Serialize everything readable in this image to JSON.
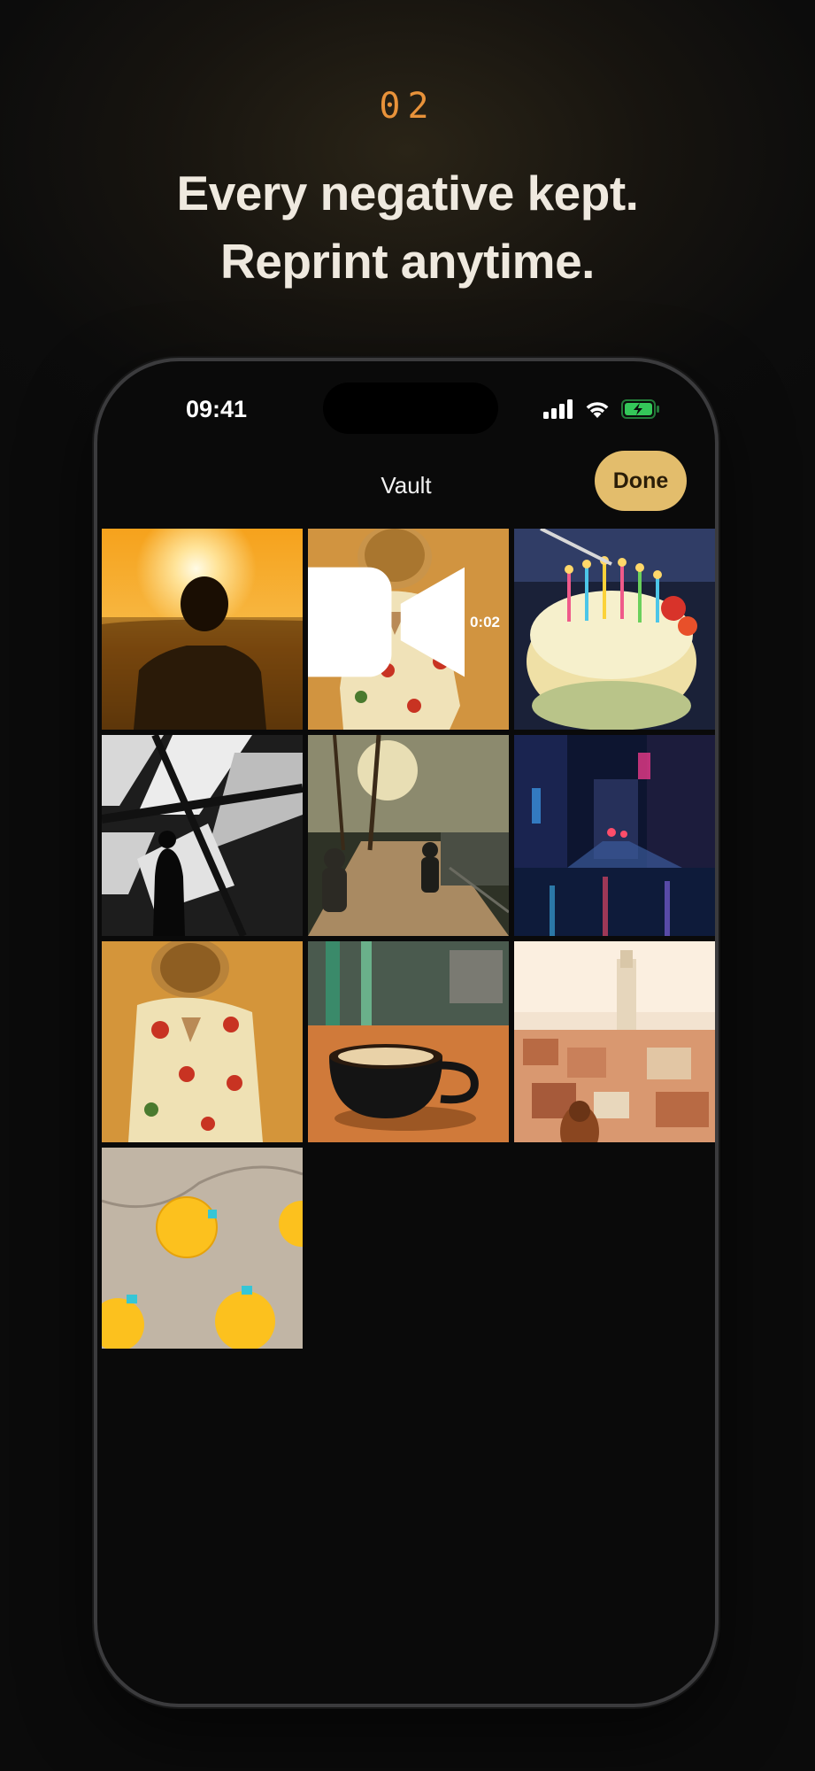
{
  "promo": {
    "step": "02",
    "headline_line1": "Every negative kept.",
    "headline_line2": "Reprint anytime."
  },
  "status_bar": {
    "time": "09:41",
    "icons": [
      "cellular-signal-icon",
      "wifi-icon",
      "battery-charging-icon"
    ],
    "battery_color": "#34c759"
  },
  "nav": {
    "title": "Vault",
    "done_label": "Done"
  },
  "accent": "#e3bd6c",
  "step_color": "#e8923a",
  "photos": [
    {
      "subject": "sunset-silhouette"
    },
    {
      "subject": "woman-floral-dress",
      "type": "video",
      "duration": "0:02"
    },
    {
      "subject": "birthday-cake"
    },
    {
      "subject": "shadow-silhouette"
    },
    {
      "subject": "autumn-street"
    },
    {
      "subject": "neon-city-night"
    },
    {
      "subject": "woman-floral-dress-2"
    },
    {
      "subject": "coffee-cup"
    },
    {
      "subject": "city-rooftops"
    },
    {
      "subject": "yellow-umbrellas"
    }
  ]
}
